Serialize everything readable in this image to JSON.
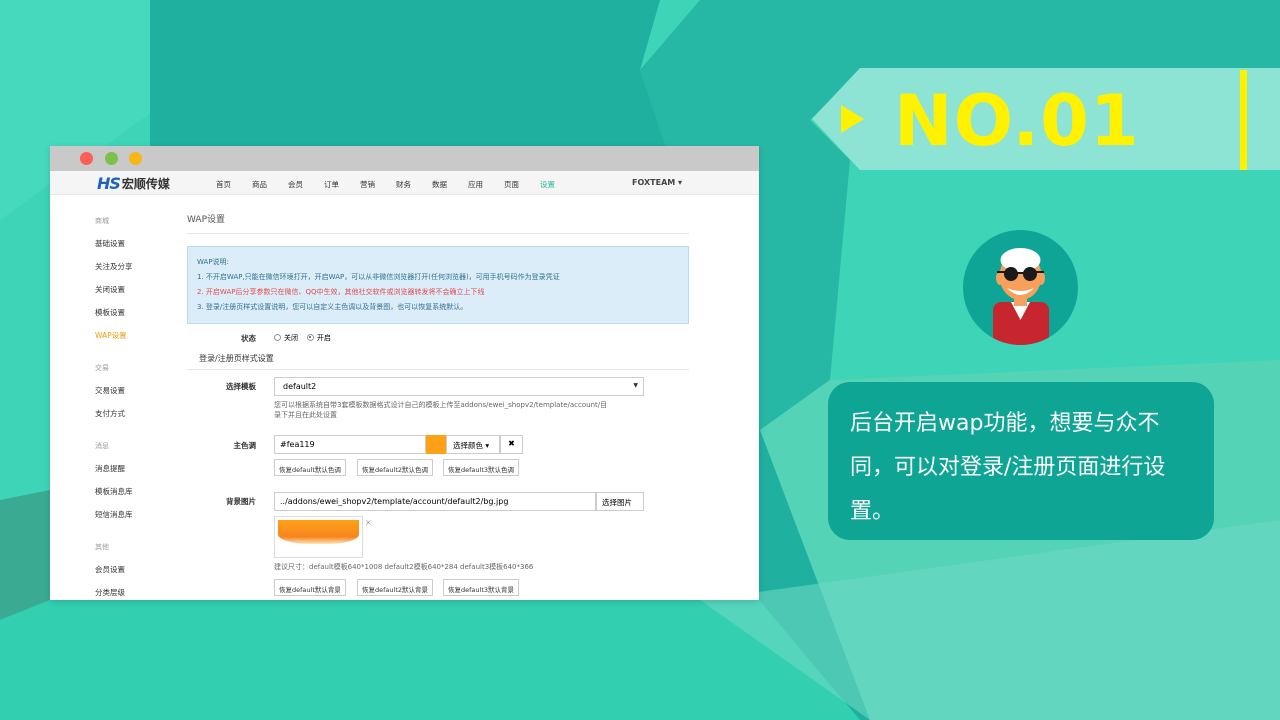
{
  "browser": {
    "logo_mark": "HS",
    "logo_text": "宏顺传媒",
    "nav": [
      "首页",
      "商品",
      "会员",
      "订单",
      "营销",
      "财务",
      "数据",
      "应用",
      "页面",
      "设置"
    ],
    "nav_active_index": 9,
    "user_menu": "FOXTEAM",
    "sidebar": {
      "group1": "商城",
      "items1": [
        "基础设置",
        "关注及分享",
        "关闭设置",
        "模板设置",
        "WAP设置"
      ],
      "active_item": "WAP设置",
      "group2": "交易",
      "items2": [
        "交易设置",
        "支付方式"
      ],
      "group3": "消息",
      "items3": [
        "消息提醒",
        "模板消息库",
        "短信消息库"
      ],
      "group4": "其他",
      "items4": [
        "会员设置",
        "分类层级"
      ]
    },
    "main": {
      "title": "WAP设置",
      "alert_title": "WAP说明:",
      "alert_line1": "1. 不开启WAP,只能在微信环境打开，开启WAP，可以从非微信浏览器打开(任何浏览器)，可用手机号码作为登录凭证",
      "alert_line2": "2. 开启WAP后分享参数只在微信、QQ中生效，其他社交软件或浏览器转发将不会确立上下线",
      "alert_line3": "3. 登录/注册页样式设置说明，您可以自定义主色调以及背景图，也可以恢复系统默认。",
      "status_label": "状态",
      "status_off": "关闭",
      "status_on": "开启",
      "status_value": "开启",
      "section_title": "登录/注册页样式设置",
      "template_label": "选择模板",
      "template_value": "default2",
      "template_hint1": "您可以根据系统自带3套模板数据格式设计自己的模板上传至addons/ewei_shopv2/template/account/目",
      "template_hint2": "录下并且在此处设置",
      "color_label": "主色调",
      "color_value": "#fea119",
      "pick_color": "选择颜色",
      "clear": "✖",
      "restore_color": [
        "恢复default默认色调",
        "恢复default2默认色调",
        "恢复default3默认色调"
      ],
      "bg_label": "背景图片",
      "bg_value": "../addons/ewei_shopv2/template/account/default2/bg.jpg",
      "bg_button": "选择图片",
      "bg_remove": "×",
      "bg_hint": "建议尺寸：default模板640*1008 default2模板640*284 default3模板640*366",
      "restore_bg": [
        "恢复default默认背景",
        "恢复default2默认背景",
        "恢复default3默认背景"
      ]
    }
  },
  "banner": {
    "number": "NO.01"
  },
  "bubble_text": "后台开启wap功能，想要与众不同，可以对登录/注册页面进行设置。",
  "colors": {
    "background": "#2ec4ad",
    "accent_yellow": "#fff200",
    "bubble": "#0ea594",
    "brand_blue": "#1e63b8",
    "active_nav": "#2bb89d",
    "active_sidebar": "#f39c12",
    "theme_orange": "#fea119"
  }
}
